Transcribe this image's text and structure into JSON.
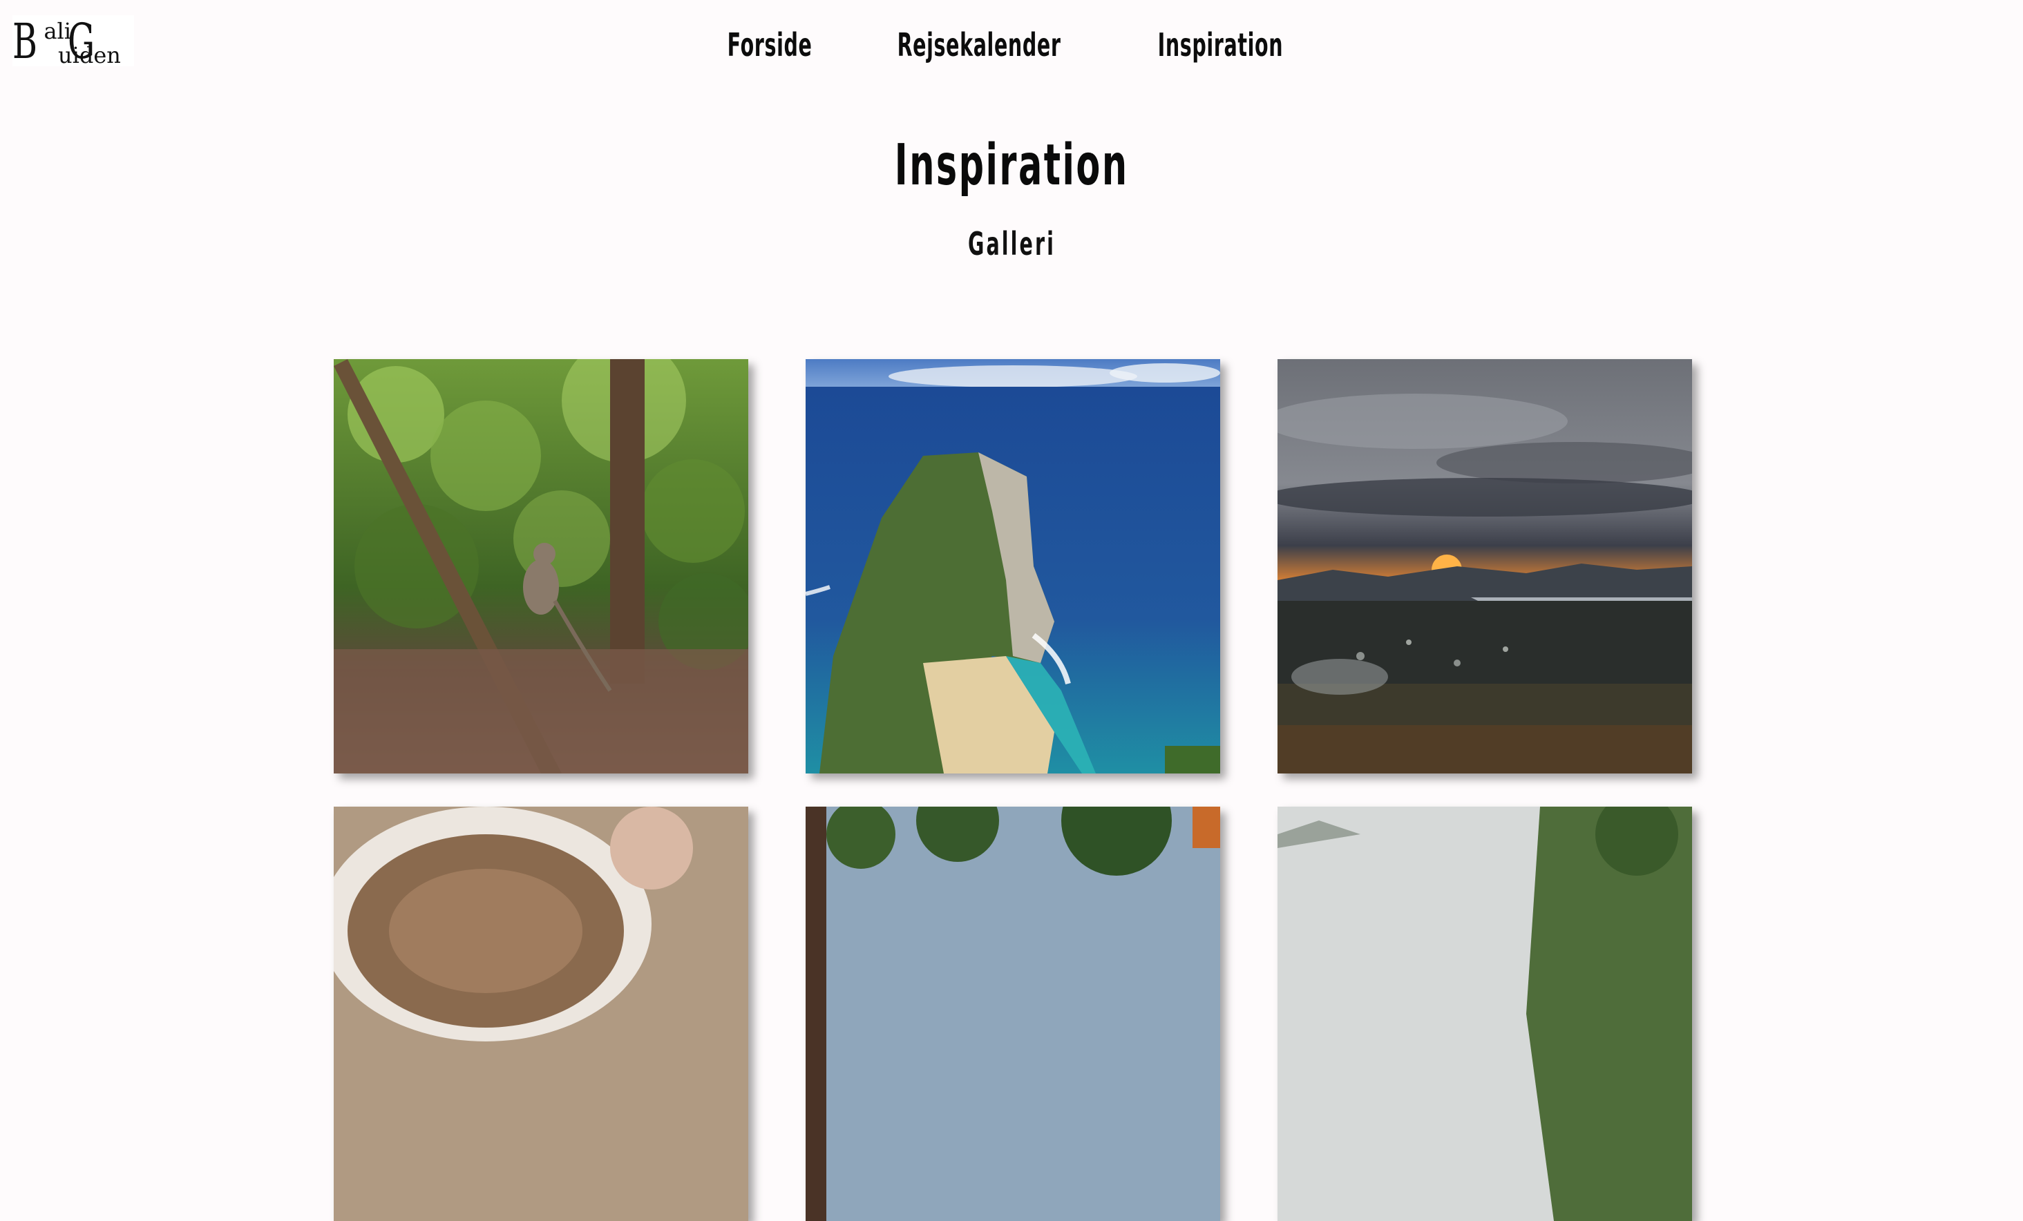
{
  "logo": {
    "letter1": "B",
    "rest1": "ali",
    "letter2": "G",
    "rest2": "uiden"
  },
  "nav": {
    "items": [
      {
        "label": "Forside"
      },
      {
        "label": "Rejsekalender"
      },
      {
        "label": "Inspiration"
      }
    ]
  },
  "page": {
    "title": "Inspiration",
    "subtitle": "Galleri"
  },
  "gallery": {
    "images": [
      {
        "subject": "monkey-in-jungle"
      },
      {
        "subject": "cliff-beach-ocean"
      },
      {
        "subject": "sunset-over-lake"
      },
      {
        "subject": "coffee-cup"
      },
      {
        "subject": "trees-and-sky"
      },
      {
        "subject": "jungle-cliff"
      }
    ]
  }
}
